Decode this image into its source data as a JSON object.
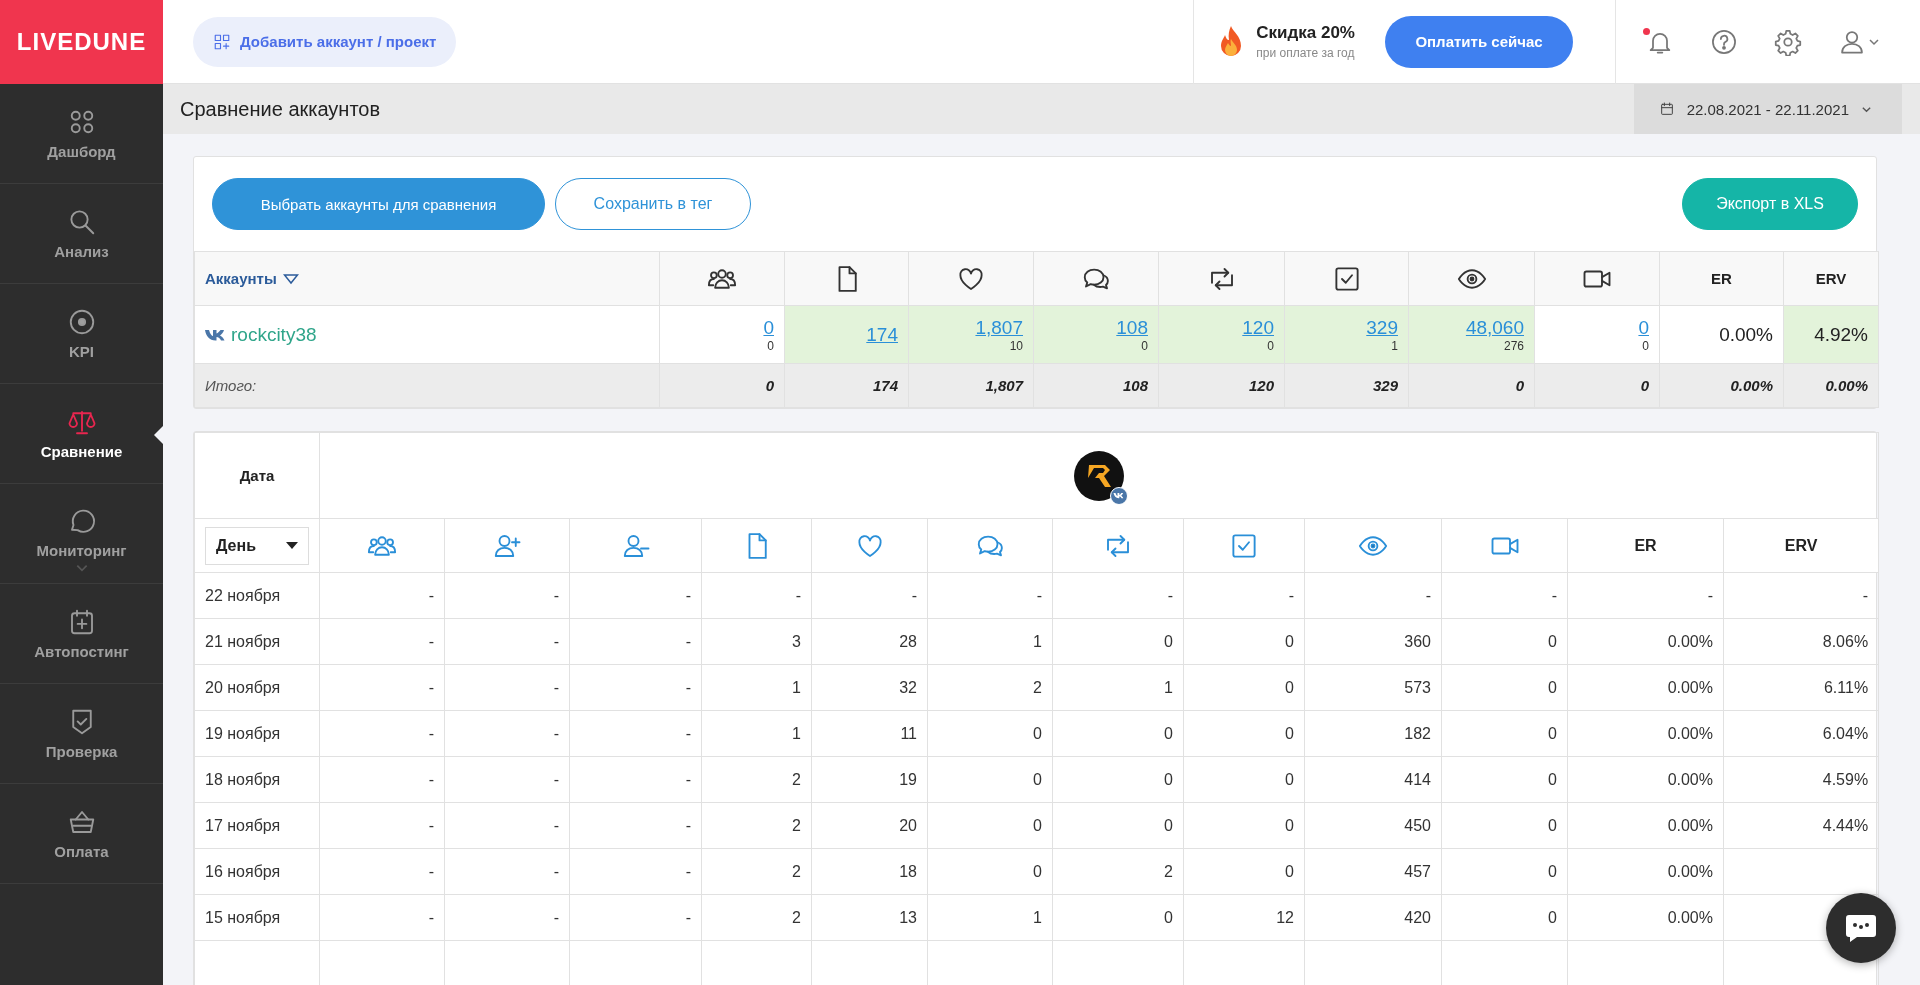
{
  "brand": {
    "logo": "LIVEDUNE"
  },
  "topbar": {
    "add_button": "Добавить аккаунт / проект",
    "promo": {
      "title": "Скидка 20%",
      "subtitle": "при оплате за год"
    },
    "pay_button": "Оплатить сейчас",
    "notifications_unread": true
  },
  "sidebar": {
    "items": [
      {
        "kind": "dashboard",
        "label": "Дашборд",
        "selected": false,
        "expandable": false
      },
      {
        "kind": "search",
        "label": "Анализ",
        "selected": false,
        "expandable": false
      },
      {
        "kind": "target",
        "label": "KPI",
        "selected": false,
        "expandable": false
      },
      {
        "kind": "scales",
        "label": "Сравнение",
        "selected": true,
        "expandable": false
      },
      {
        "kind": "bubble",
        "label": "Мониторинг",
        "selected": false,
        "expandable": true
      },
      {
        "kind": "calendar",
        "label": "Автопостинг",
        "selected": false,
        "expandable": false
      },
      {
        "kind": "shield",
        "label": "Проверка",
        "selected": false,
        "expandable": false
      },
      {
        "kind": "basket",
        "label": "Оплата",
        "selected": false,
        "expandable": false
      }
    ]
  },
  "page": {
    "title": "Сравнение аккаунтов",
    "date_range": "22.08.2021 - 22.11.2021"
  },
  "summary": {
    "choose_button": "Выбрать аккаунты для сравнения",
    "save_button": "Сохранить в тег",
    "export_button": "Экспорт в XLS",
    "accounts_header": "Аккаунты",
    "columns": [
      {
        "kind": "followers"
      },
      {
        "kind": "posts"
      },
      {
        "kind": "likes"
      },
      {
        "kind": "comments"
      },
      {
        "kind": "reposts"
      },
      {
        "kind": "polls"
      },
      {
        "kind": "views"
      },
      {
        "kind": "videos"
      },
      {
        "kind": "label",
        "label": "ER"
      },
      {
        "kind": "label",
        "label": "ERV"
      }
    ],
    "rows": [
      {
        "name": "rockcity38",
        "cells": [
          {
            "kind": "link",
            "value": "0",
            "sub": "0",
            "highlighted": false
          },
          {
            "kind": "link",
            "value": "174",
            "highlighted": true
          },
          {
            "kind": "link",
            "value": "1,807",
            "sub": "10",
            "highlighted": true
          },
          {
            "kind": "link",
            "value": "108",
            "sub": "0",
            "highlighted": true
          },
          {
            "kind": "link",
            "value": "120",
            "sub": "0",
            "highlighted": true
          },
          {
            "kind": "link",
            "value": "329",
            "sub": "1",
            "highlighted": true
          },
          {
            "kind": "link",
            "value": "48,060",
            "sub": "276",
            "highlighted": true
          },
          {
            "kind": "link",
            "value": "0",
            "sub": "0",
            "highlighted": false
          },
          {
            "kind": "plain",
            "value": "0.00%",
            "highlighted": false
          },
          {
            "kind": "plain",
            "value": "4.92%",
            "highlighted": true
          }
        ]
      }
    ],
    "total": {
      "label": "Итого:",
      "values": [
        "0",
        "174",
        "1,807",
        "108",
        "120",
        "329",
        "0",
        "0",
        "0.00%",
        "0.00%"
      ]
    }
  },
  "daily": {
    "date_header": "Дата",
    "period": "День",
    "columns": [
      {
        "kind": "followers"
      },
      {
        "kind": "follow"
      },
      {
        "kind": "unfollow"
      },
      {
        "kind": "posts"
      },
      {
        "kind": "likes"
      },
      {
        "kind": "comments"
      },
      {
        "kind": "reposts"
      },
      {
        "kind": "polls"
      },
      {
        "kind": "views"
      },
      {
        "kind": "videos"
      },
      {
        "kind": "label",
        "label": "ER"
      },
      {
        "kind": "label",
        "label": "ERV"
      }
    ],
    "rows": [
      {
        "date": "22 ноября",
        "values": [
          "-",
          "-",
          "-",
          "-",
          "-",
          "-",
          "-",
          "-",
          "-",
          "-",
          "-",
          "-"
        ]
      },
      {
        "date": "21 ноября",
        "values": [
          "-",
          "-",
          "-",
          "3",
          "28",
          "1",
          "0",
          "0",
          "360",
          "0",
          "0.00%",
          "8.06%"
        ]
      },
      {
        "date": "20 ноября",
        "values": [
          "-",
          "-",
          "-",
          "1",
          "32",
          "2",
          "1",
          "0",
          "573",
          "0",
          "0.00%",
          "6.11%"
        ]
      },
      {
        "date": "19 ноября",
        "values": [
          "-",
          "-",
          "-",
          "1",
          "11",
          "0",
          "0",
          "0",
          "182",
          "0",
          "0.00%",
          "6.04%"
        ]
      },
      {
        "date": "18 ноября",
        "values": [
          "-",
          "-",
          "-",
          "2",
          "19",
          "0",
          "0",
          "0",
          "414",
          "0",
          "0.00%",
          "4.59%"
        ]
      },
      {
        "date": "17 ноября",
        "values": [
          "-",
          "-",
          "-",
          "2",
          "20",
          "0",
          "0",
          "0",
          "450",
          "0",
          "0.00%",
          "4.44%"
        ]
      },
      {
        "date": "16 ноября",
        "values": [
          "-",
          "-",
          "-",
          "2",
          "18",
          "0",
          "2",
          "0",
          "457",
          "0",
          "0.00%"
        ]
      },
      {
        "date": "15 ноября",
        "values": [
          "-",
          "-",
          "-",
          "2",
          "13",
          "1",
          "0",
          "12",
          "420",
          "0",
          "0.00%"
        ]
      }
    ]
  }
}
